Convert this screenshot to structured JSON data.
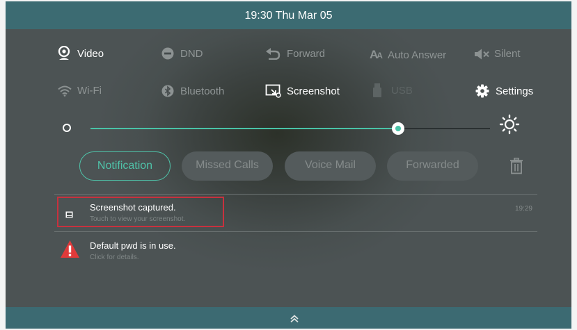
{
  "status_bar": {
    "time": "19:30 Thu Mar 05"
  },
  "quick_settings": {
    "row1": [
      {
        "label": "Video",
        "icon": "webcam-icon",
        "state": "on"
      },
      {
        "label": "DND",
        "icon": "do-not-disturb-icon",
        "state": "off"
      },
      {
        "label": "Forward",
        "icon": "forward-arrow-icon",
        "state": "off"
      },
      {
        "label": "Auto Answer",
        "icon": "auto-answer-icon",
        "state": "off"
      },
      {
        "label": "Silent",
        "icon": "speaker-mute-icon",
        "state": "off"
      }
    ],
    "row2": [
      {
        "label": "Wi-Fi",
        "icon": "wifi-icon",
        "state": "off"
      },
      {
        "label": "Bluetooth",
        "icon": "bluetooth-icon",
        "state": "off"
      },
      {
        "label": "Screenshot",
        "icon": "screenshot-icon",
        "state": "on"
      },
      {
        "label": "USB",
        "icon": "usb-icon",
        "state": "disabled"
      },
      {
        "label": "Settings",
        "icon": "gear-icon",
        "state": "on"
      }
    ]
  },
  "brightness": {
    "level": 0.77,
    "accent": "#49c3a7"
  },
  "tabs": [
    {
      "label": "Notification",
      "active": true
    },
    {
      "label": "Missed Calls",
      "active": false
    },
    {
      "label": "Voice Mail",
      "active": false
    },
    {
      "label": "Forwarded",
      "active": false
    }
  ],
  "notifications": [
    {
      "title": "Screenshot captured.",
      "subtitle": "Touch to view your screenshot.",
      "time": "19:29",
      "icon": "image-icon"
    },
    {
      "title": "Default pwd is in use.",
      "subtitle": "Click for details.",
      "time": "",
      "icon": "warning-icon"
    }
  ],
  "colors": {
    "accent": "#4fc3a9",
    "highlight": "#c8313e",
    "warning": "#e03a3a",
    "bar": "#3c6b72"
  }
}
